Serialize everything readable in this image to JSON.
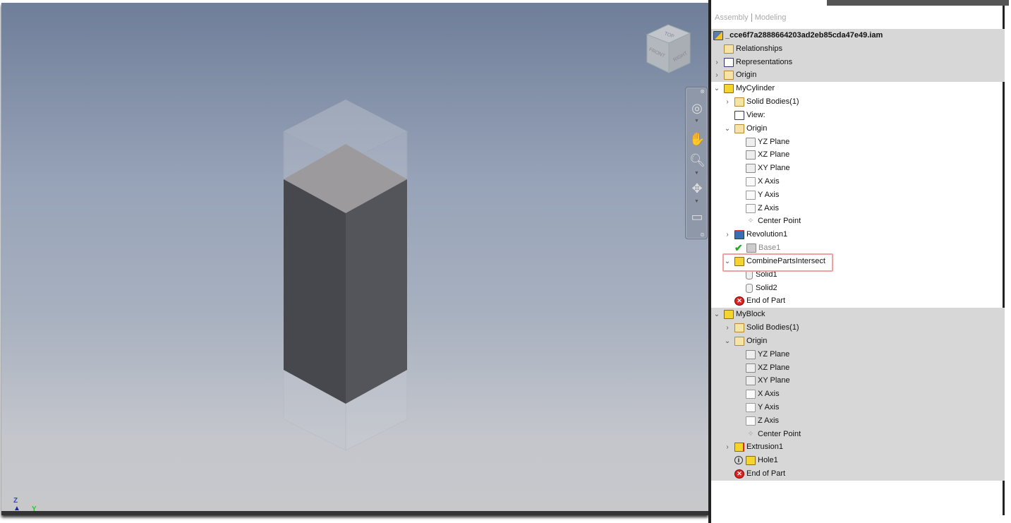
{
  "browser_tabs": {
    "assembly": "Assembly",
    "modeling": "Modeling"
  },
  "viewcube": {
    "top": "TOP",
    "front": "FRONT",
    "right": "RIGHT"
  },
  "triad": {
    "z": "Z",
    "y": "Y"
  },
  "nav_bar": [
    "steering-wheel-icon",
    "pan-icon",
    "zoom-icon",
    "orbit-icon",
    "look-at-icon"
  ],
  "colors": {
    "highlight": "#f2a0a0",
    "tree_gray": "#d7d7d7"
  },
  "tree": [
    {
      "label": "_cce6f7a2888664203ad2eb85cda47e49.iam",
      "level": 0,
      "icon": "asm",
      "bold": true,
      "gray": true
    },
    {
      "label": "Relationships",
      "level": 1,
      "icon": "folder",
      "gray": true
    },
    {
      "label": "Representations",
      "level": 1,
      "icon": "view",
      "chevron": ">",
      "gray": true
    },
    {
      "label": "Origin",
      "level": 1,
      "icon": "folder",
      "chevron": ">",
      "gray": true
    },
    {
      "label": "MyCylinder",
      "level": 1,
      "icon": "part",
      "chevron": "v"
    },
    {
      "label": "Solid Bodies(1)",
      "level": 2,
      "icon": "folder",
      "chevron": ">"
    },
    {
      "label": "View:",
      "level": 2,
      "icon": "view"
    },
    {
      "label": "Origin",
      "level": 2,
      "icon": "folder",
      "chevron": "v"
    },
    {
      "label": "YZ Plane",
      "level": 3,
      "icon": "plane"
    },
    {
      "label": "XZ Plane",
      "level": 3,
      "icon": "plane"
    },
    {
      "label": "XY Plane",
      "level": 3,
      "icon": "plane"
    },
    {
      "label": "X Axis",
      "level": 3,
      "icon": "axis"
    },
    {
      "label": "Y Axis",
      "level": 3,
      "icon": "axis"
    },
    {
      "label": "Z Axis",
      "level": 3,
      "icon": "axis"
    },
    {
      "label": "Center Point",
      "level": 3,
      "icon": "point"
    },
    {
      "label": "Revolution1",
      "level": 2,
      "icon": "rev",
      "chevron": ">"
    },
    {
      "label": "Base1",
      "level": 2,
      "icon": "base",
      "muted": true,
      "check": true
    },
    {
      "label": "CombinePartsIntersect",
      "level": 2,
      "icon": "part",
      "chevron": "v",
      "highlighted": true
    },
    {
      "label": "Solid1",
      "level": 3,
      "icon": "solid"
    },
    {
      "label": "Solid2",
      "level": 3,
      "icon": "solid"
    },
    {
      "label": "End of Part",
      "level": 2,
      "icon": "end"
    },
    {
      "label": "MyBlock",
      "level": 1,
      "icon": "part",
      "chevron": "v",
      "gray": true
    },
    {
      "label": "Solid Bodies(1)",
      "level": 2,
      "icon": "folder",
      "chevron": ">",
      "gray": true
    },
    {
      "label": "Origin",
      "level": 2,
      "icon": "folder",
      "chevron": "v",
      "gray": true
    },
    {
      "label": "YZ Plane",
      "level": 3,
      "icon": "plane",
      "gray": true
    },
    {
      "label": "XZ Plane",
      "level": 3,
      "icon": "plane",
      "gray": true
    },
    {
      "label": "XY Plane",
      "level": 3,
      "icon": "plane",
      "gray": true
    },
    {
      "label": "X Axis",
      "level": 3,
      "icon": "axis",
      "gray": true
    },
    {
      "label": "Y Axis",
      "level": 3,
      "icon": "axis",
      "gray": true
    },
    {
      "label": "Z Axis",
      "level": 3,
      "icon": "axis",
      "gray": true
    },
    {
      "label": "Center Point",
      "level": 3,
      "icon": "point",
      "gray": true
    },
    {
      "label": "Extrusion1",
      "level": 2,
      "icon": "extr",
      "chevron": ">",
      "gray": true
    },
    {
      "label": "Hole1",
      "level": 2,
      "icon": "part",
      "info": true,
      "gray": true
    },
    {
      "label": "End of Part",
      "level": 2,
      "icon": "end",
      "gray": true
    }
  ]
}
